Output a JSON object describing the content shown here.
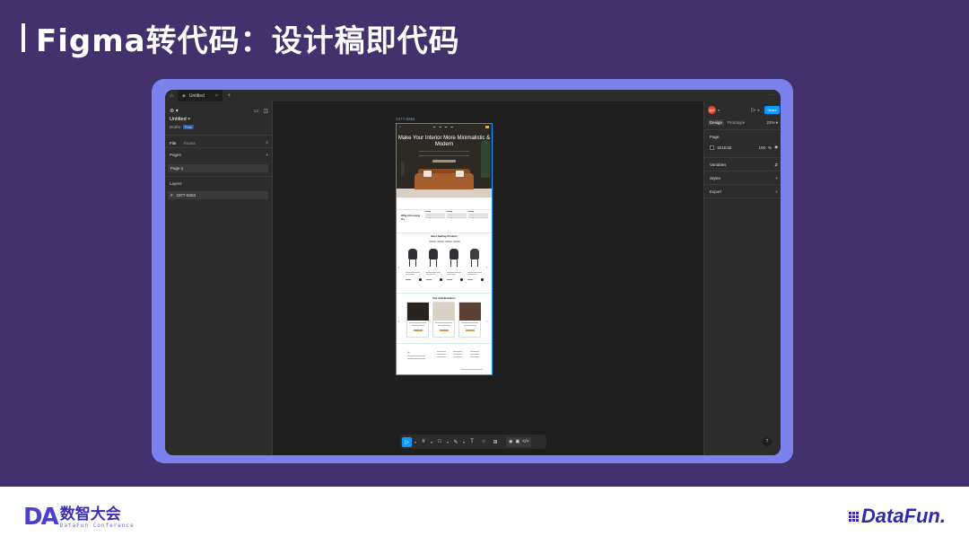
{
  "slide": {
    "title": "Figma转代码：设计稿即代码"
  },
  "window": {
    "tab_label": "Untitled",
    "tab_close": "×",
    "tab_add": "+",
    "more": "···"
  },
  "left_panel": {
    "file_name": "Untitled",
    "drafts_label": "Drafts",
    "plan_badge": "Free",
    "tabs": [
      "File",
      "Assets"
    ],
    "pages_label": "Pages",
    "pages_add": "+",
    "pages": [
      "Page 1"
    ],
    "layers_label": "Layers",
    "layers": [
      "2377-8253"
    ]
  },
  "canvas": {
    "frame_label": "2377-8253",
    "hero_title": "Make Your Interior More Minimalistic & Modern",
    "why_title": "Why Choosing Us",
    "products_title": "Best Selling Product",
    "inspiration_title": "Our Glorifications"
  },
  "toolbar": {
    "tools": [
      {
        "name": "move-tool",
        "glyph": "▷",
        "active": true
      },
      {
        "name": "frame-tool",
        "glyph": "#",
        "active": false
      },
      {
        "name": "shape-tool",
        "glyph": "□",
        "active": false
      },
      {
        "name": "pen-tool",
        "glyph": "✎",
        "active": false
      },
      {
        "name": "text-tool",
        "glyph": "T",
        "active": false
      },
      {
        "name": "comment-tool",
        "glyph": "○",
        "active": false
      },
      {
        "name": "actions-tool",
        "glyph": "⊞",
        "active": false
      }
    ],
    "modes": [
      "◉",
      "▣",
      "</>"
    ]
  },
  "right_panel": {
    "avatar_text": "用户",
    "share_label": "Share",
    "tabs": [
      "Design",
      "Prototype"
    ],
    "zoom": "21%",
    "page_label": "Page",
    "bg_hex": "1E1E1E",
    "bg_opacity": "100",
    "bg_opacity_unit": "%",
    "variables_label": "Variables",
    "styles_label": "Styles",
    "export_label": "Export",
    "help": "?"
  },
  "footer": {
    "da_mark": "DA",
    "da_cn": "数智大会",
    "da_en": "DataFun Conference",
    "datafun_name": "DataFun."
  },
  "colors": {
    "slide_bg": "#43316d",
    "frame": "#7b82ee",
    "accent": "#0d99ff",
    "panel": "#2c2c2c",
    "canvas": "#1e1e1e"
  }
}
